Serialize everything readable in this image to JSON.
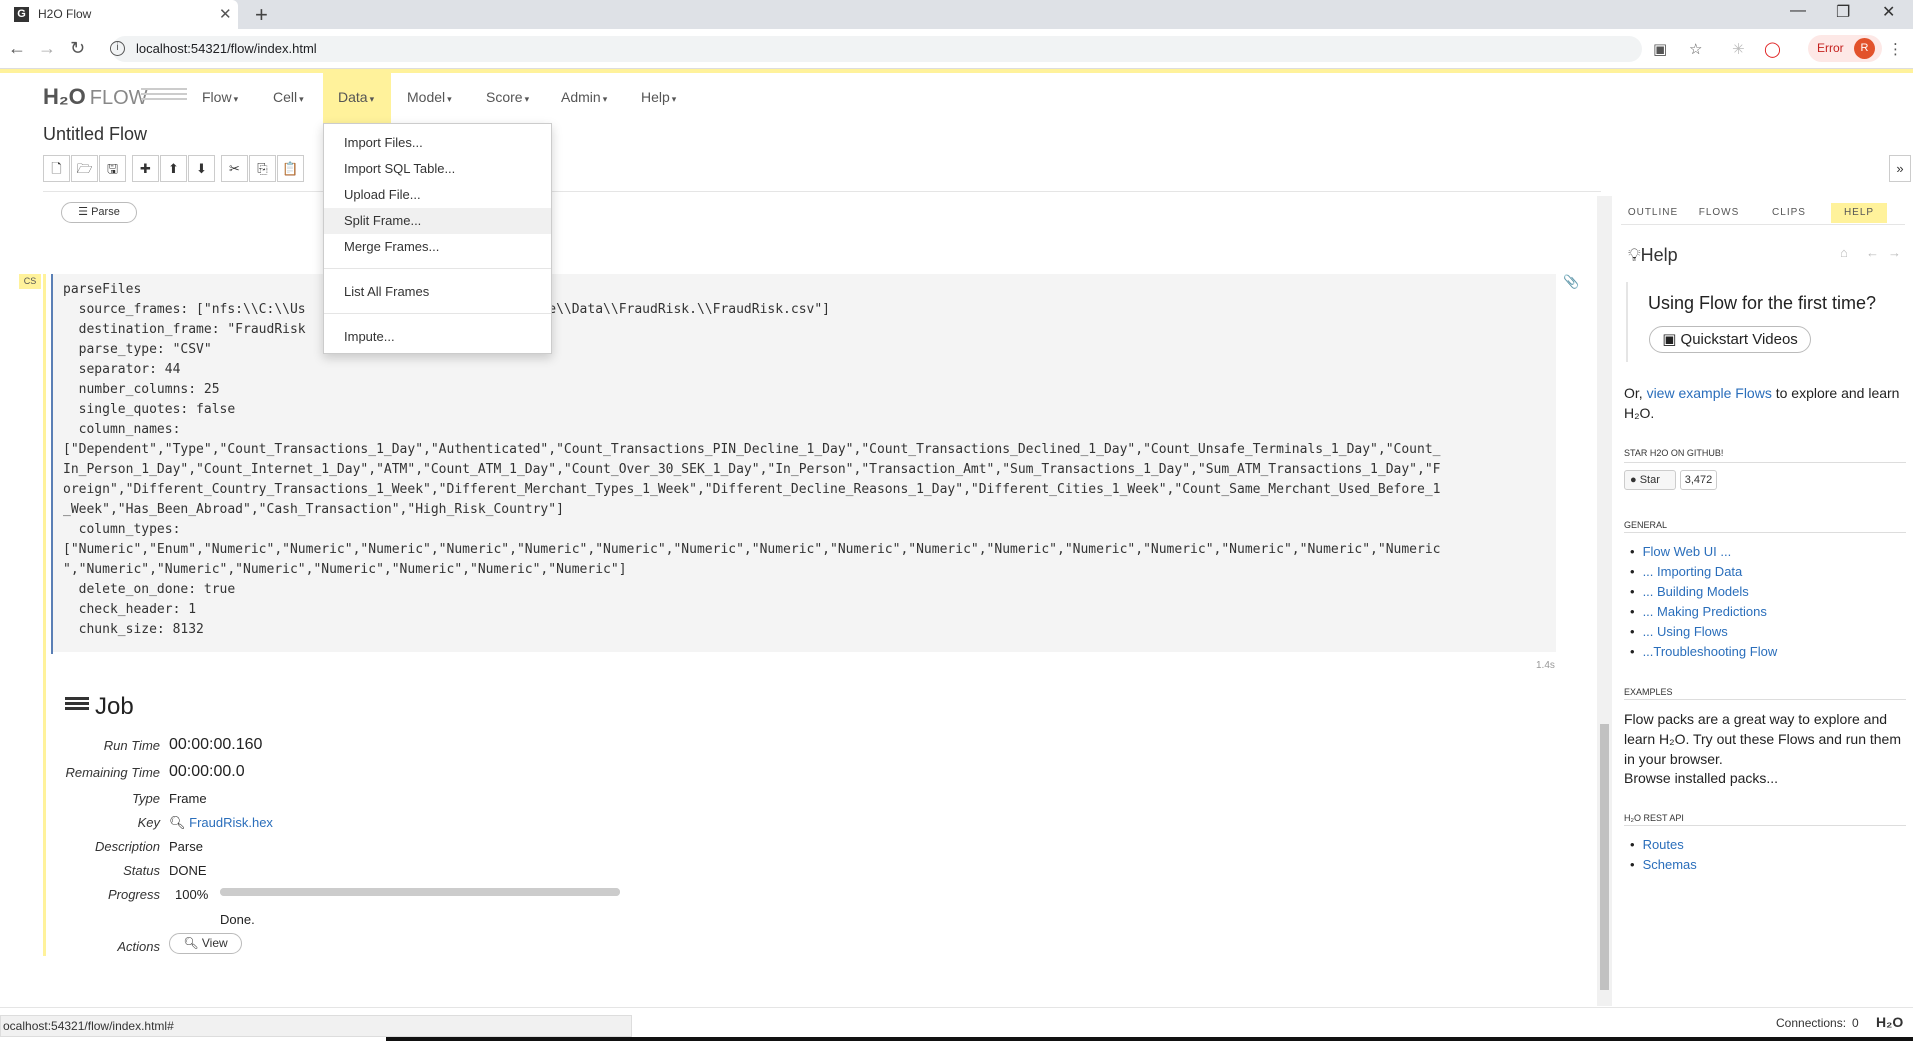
{
  "browser": {
    "tab_title": "H2O Flow",
    "url": "localhost:54321/flow/index.html",
    "error_label": "Error",
    "avatar_letter": "R"
  },
  "app": {
    "logo_text": "H₂O",
    "logo_flow": "FLOW",
    "flow_title": "Untitled Flow",
    "menus": [
      "Flow",
      "Cell",
      "Data",
      "Model",
      "Score",
      "Admin",
      "Help"
    ],
    "active_menu": "Data"
  },
  "dropdown": {
    "items": [
      "Import Files...",
      "Import SQL Table...",
      "Upload File...",
      "Split Frame...",
      "Merge Frames...",
      "List All Frames",
      "Impute..."
    ],
    "hovered": "Split Frame..."
  },
  "cell": {
    "parse_button": "Parse",
    "tag": "CS",
    "timing": "1.4s",
    "code_lines": [
      "parseFiles",
      "  source_frames: [\"nfs:\\\\C:\\\\Us                              le\\\\Data\\\\FraudRisk.\\\\FraudRisk.csv\"]",
      "  destination_frame: \"FraudRisk",
      "  parse_type: \"CSV\"",
      "  separator: 44",
      "  number_columns: 25",
      "  single_quotes: false",
      "  column_names:",
      "[\"Dependent\",\"Type\",\"Count_Transactions_1_Day\",\"Authenticated\",\"Count_Transactions_PIN_Decline_1_Day\",\"Count_Transactions_Declined_1_Day\",\"Count_Unsafe_Terminals_1_Day\",\"Count_",
      "In_Person_1_Day\",\"Count_Internet_1_Day\",\"ATM\",\"Count_ATM_1_Day\",\"Count_Over_30_SEK_1_Day\",\"In_Person\",\"Transaction_Amt\",\"Sum_Transactions_1_Day\",\"Sum_ATM_Transactions_1_Day\",\"F",
      "oreign\",\"Different_Country_Transactions_1_Week\",\"Different_Merchant_Types_1_Week\",\"Different_Decline_Reasons_1_Day\",\"Different_Cities_1_Week\",\"Count_Same_Merchant_Used_Before_1",
      "_Week\",\"Has_Been_Abroad\",\"Cash_Transaction\",\"High_Risk_Country\"]",
      "  column_types:",
      "[\"Numeric\",\"Enum\",\"Numeric\",\"Numeric\",\"Numeric\",\"Numeric\",\"Numeric\",\"Numeric\",\"Numeric\",\"Numeric\",\"Numeric\",\"Numeric\",\"Numeric\",\"Numeric\",\"Numeric\",\"Numeric\",\"Numeric\",\"Numeric",
      "\",\"Numeric\",\"Numeric\",\"Numeric\",\"Numeric\",\"Numeric\",\"Numeric\",\"Numeric\"]",
      "  delete_on_done: true",
      "  check_header: 1",
      "  chunk_size: 8132"
    ]
  },
  "job": {
    "title": "Job",
    "labels": {
      "run_time": "Run Time",
      "remaining_time": "Remaining Time",
      "type": "Type",
      "key": "Key",
      "description": "Description",
      "status": "Status",
      "progress": "Progress",
      "actions": "Actions"
    },
    "run_time": "00:00:00.160",
    "remaining_time": "00:00:00.0",
    "type": "Frame",
    "key": "FraudRisk.hex",
    "description": "Parse",
    "status": "DONE",
    "progress_text": "100%",
    "progress_value": 1.0,
    "done_text": "Done.",
    "view_button": "View"
  },
  "help_panel": {
    "tabs": [
      "OUTLINE",
      "FLOWS",
      "CLIPS",
      "HELP"
    ],
    "active_tab": "HELP",
    "heading": "Help",
    "first_time": "Using Flow for the first time?",
    "quickstart": "Quickstart Videos",
    "or_text_1": "Or, ",
    "or_link": "view example Flows",
    "or_text_2": " to explore and learn H₂O.",
    "github_section": "STAR H2O ON GITHUB!",
    "star_label": "Star",
    "star_count": "3,472",
    "general_section": "GENERAL",
    "general_links": [
      "Flow Web UI ...",
      "... Importing Data",
      "... Building Models",
      "... Making Predictions",
      "... Using Flows",
      "...Troubleshooting Flow"
    ],
    "examples_section": "EXAMPLES",
    "examples_text": "Flow packs are a great way to explore and learn H₂O. Try out these Flows and run them in your browser.",
    "examples_link": "Browse installed packs...",
    "rest_section": "H₂O REST API",
    "rest_links": [
      "Routes",
      "Schemas"
    ]
  },
  "statusbar": {
    "hover_url": "ocalhost:54321/flow/index.html#",
    "connections_label": "Connections:",
    "connections_count": "0",
    "footer_logo": "H₂O"
  }
}
